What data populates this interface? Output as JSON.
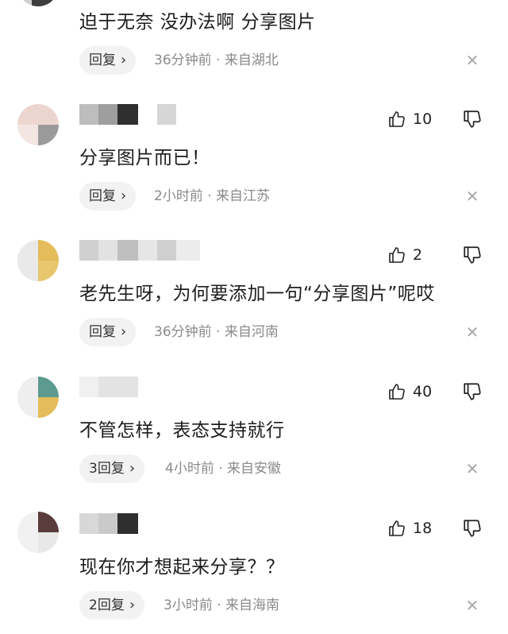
{
  "comments": [
    {
      "text": "迫于无奈 没办法啊 分享图片",
      "reply_label": "回复",
      "meta": "36分钟前 · 来自湖北"
    },
    {
      "likes": "10",
      "text": "分享图片而已！",
      "reply_label": "回复",
      "meta": "2小时前 · 来自江苏"
    },
    {
      "likes": "2",
      "text": "老先生呀，为何要添加一句“分享图片”呢哎",
      "reply_label": "回复",
      "meta": "36分钟前 · 来自河南"
    },
    {
      "likes": "40",
      "text": "不管怎样，表态支持就行",
      "reply_label": "3回复",
      "meta": "4小时前 · 来自安徽"
    },
    {
      "likes": "18",
      "text": "现在你才想起来分享？？",
      "reply_label": "2回复",
      "meta": "3小时前 · 来自海南"
    }
  ],
  "icons": {
    "chevron": "chevron-right-icon",
    "like": "thumbs-up-icon",
    "dislike": "thumbs-down-icon",
    "close": "close-icon"
  },
  "colors": {
    "reply_bg": "#f2f2f2",
    "meta_text": "#8a8a8a",
    "blur_pink": "#e8c9c2",
    "blur_dark": "#3a3a3a",
    "blur_yellow": "#e4bc5a",
    "blur_teal": "#5d9a90"
  }
}
